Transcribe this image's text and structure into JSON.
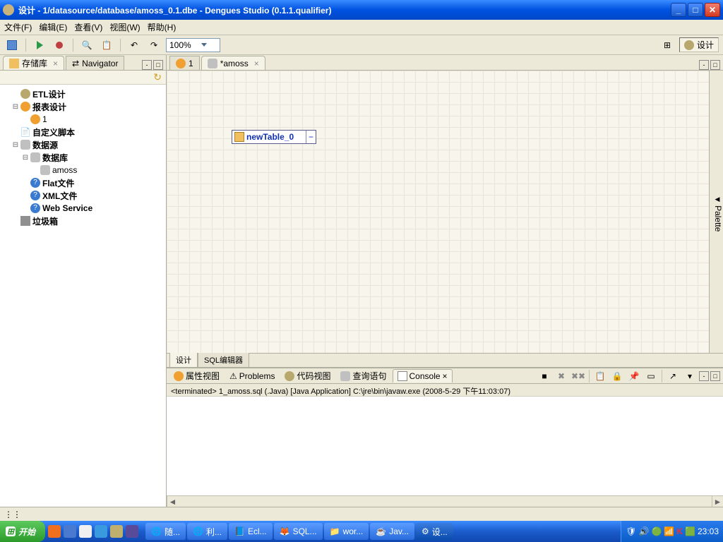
{
  "titlebar": {
    "title": "设计 - 1/datasource/database/amoss_0.1.dbe  - Dengues Studio (0.1.1.qualifier)"
  },
  "menu": {
    "file": "文件(F)",
    "edit": "编辑(E)",
    "view": "查看(V)",
    "view2": "视图(W)",
    "help": "帮助(H)"
  },
  "toolbar": {
    "zoom": "100%",
    "perspective": "设计"
  },
  "leftTabs": {
    "repo": "存储库",
    "nav": "Navigator"
  },
  "tree": {
    "etl": "ETL设计",
    "report": "报表设计",
    "one": "1",
    "script": "自定义脚本",
    "datasource": "数据源",
    "database": "数据库",
    "amoss": "amoss",
    "flat": "Flat文件",
    "xml": "XML文件",
    "ws": "Web Service",
    "trash": "垃圾箱"
  },
  "editorTabs": {
    "one": "1",
    "amoss": "*amoss"
  },
  "canvas": {
    "table": "newTable_0",
    "palette": "Palette"
  },
  "bottomTabs": {
    "design": "设计",
    "sql": "SQL编辑器"
  },
  "console": {
    "tabs": {
      "prop": "属性视图",
      "problems": "Problems",
      "code": "代码视图",
      "query": "查询语句",
      "console": "Console"
    },
    "term": "<terminated> 1_amoss.sql (.Java) [Java Application] C:\\jre\\bin\\javaw.exe (2008-5-29 下午11:03:07)"
  },
  "taskbar": {
    "start": "开始",
    "tasks": [
      "随...",
      "利...",
      "Ecl...",
      "SQL...",
      "wor...",
      "Jav...",
      "设..."
    ]
  },
  "systray": {
    "time": "23:03"
  }
}
